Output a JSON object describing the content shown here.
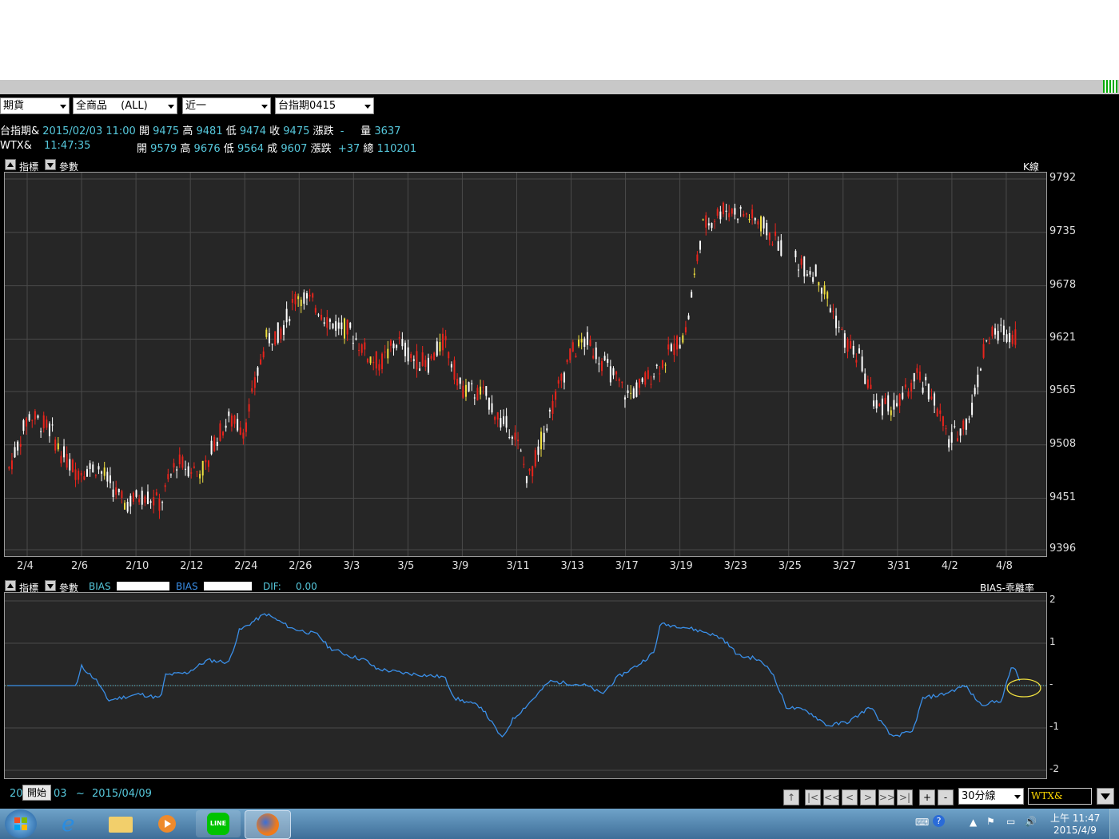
{
  "toolbar": {
    "market_select": "期貨",
    "product_select": "全商品　 (ALL)",
    "period_select": "近一",
    "contract_select": "台指期0415"
  },
  "quote_rows": [
    {
      "name": "台指期&",
      "time": "2015/02/03 11:00",
      "open_label": "開",
      "open": "9475",
      "high_label": "高",
      "high": "9481",
      "low_label": "低",
      "low": "9474",
      "close_label": "收",
      "close": "9475",
      "chg_label": "漲跌",
      "chg": "-",
      "vol_label": "量",
      "vol": "3637"
    },
    {
      "name": "WTX&",
      "time": "11:47:35",
      "open_label": "開",
      "open": "9579",
      "high_label": "高",
      "high": "9676",
      "low_label": "低",
      "low": "9564",
      "close_label": "成",
      "close": "9607",
      "chg_label": "漲跌",
      "chg": "+37",
      "vol_label": "總",
      "vol": "110201"
    }
  ],
  "upper_panel": {
    "indicator_label": "指標",
    "param_label": "參數",
    "chart_type_label": "K線"
  },
  "lower_panel": {
    "indicator_label": "指標",
    "param_label": "參數",
    "bias1_label": "BIAS",
    "bias2_label": "BIAS",
    "dif_label": "DIF:",
    "dif_value": "0.00",
    "title": "BIAS-乖離率"
  },
  "footer": {
    "date_start": "20",
    "start_button": "開始",
    "date_mid": "03",
    "tilde": "~",
    "date_end": "2015/04/09",
    "nav_buttons": [
      "↑",
      "|<",
      "<<",
      "<",
      ">",
      ">>",
      ">|"
    ],
    "zoom_buttons": [
      "+",
      "-"
    ],
    "interval_select": "30分線",
    "symbol_input": "WTX&"
  },
  "taskbar": {
    "clock_time": "上午 11:47",
    "clock_date": "2015/4/9",
    "line_label": "LINE"
  },
  "chart_data": [
    {
      "type": "candlestick",
      "title": "K線",
      "x_ticks": [
        "2/4",
        "2/6",
        "2/10",
        "2/12",
        "2/24",
        "2/26",
        "3/3",
        "3/5",
        "3/9",
        "3/11",
        "3/13",
        "3/17",
        "3/19",
        "3/23",
        "3/25",
        "3/27",
        "3/31",
        "4/2",
        "4/8"
      ],
      "y_ticks": [
        9792,
        9735,
        9678,
        9621,
        9565,
        9508,
        9451,
        9396
      ],
      "ylim": [
        9396,
        9792
      ],
      "x_range": [
        0,
        19.2
      ],
      "price_path": [
        [
          0.0,
          9480
        ],
        [
          0.4,
          9540
        ],
        [
          0.8,
          9525
        ],
        [
          1.0,
          9500
        ],
        [
          1.3,
          9480
        ],
        [
          1.7,
          9485
        ],
        [
          1.9,
          9470
        ],
        [
          2.2,
          9445
        ],
        [
          2.6,
          9455
        ],
        [
          2.9,
          9445
        ],
        [
          3.0,
          9460
        ],
        [
          3.2,
          9490
        ],
        [
          3.6,
          9480
        ],
        [
          3.8,
          9485
        ],
        [
          3.9,
          9510
        ],
        [
          4.2,
          9535
        ],
        [
          4.5,
          9525
        ],
        [
          4.9,
          9620
        ],
        [
          5.2,
          9630
        ],
        [
          5.5,
          9670
        ],
        [
          5.9,
          9655
        ],
        [
          6.1,
          9640
        ],
        [
          6.5,
          9630
        ],
        [
          6.9,
          9600
        ],
        [
          7.1,
          9595
        ],
        [
          7.4,
          9620
        ],
        [
          7.7,
          9600
        ],
        [
          8.0,
          9595
        ],
        [
          8.3,
          9620
        ],
        [
          8.6,
          9570
        ],
        [
          9.1,
          9560
        ],
        [
          9.4,
          9530
        ],
        [
          9.6,
          9525
        ],
        [
          9.9,
          9470
        ],
        [
          10.3,
          9540
        ],
        [
          10.7,
          9605
        ],
        [
          11.0,
          9620
        ],
        [
          11.4,
          9590
        ],
        [
          11.8,
          9560
        ],
        [
          12.1,
          9575
        ],
        [
          12.5,
          9600
        ],
        [
          12.9,
          9630
        ],
        [
          13.2,
          9740
        ],
        [
          13.6,
          9760
        ],
        [
          14.0,
          9755
        ],
        [
          14.3,
          9745
        ],
        [
          14.7,
          9720
        ],
        [
          15.1,
          9700
        ],
        [
          15.4,
          9690
        ],
        [
          15.9,
          9620
        ],
        [
          16.2,
          9600
        ],
        [
          16.5,
          9550
        ],
        [
          16.9,
          9550
        ],
        [
          17.3,
          9580
        ],
        [
          17.6,
          9560
        ],
        [
          17.9,
          9510
        ],
        [
          18.3,
          9540
        ],
        [
          18.6,
          9620
        ],
        [
          18.9,
          9630
        ],
        [
          19.2,
          9625
        ]
      ]
    },
    {
      "type": "line",
      "title": "BIAS-乖離率",
      "series_name": "BIAS",
      "y_ticks": [
        "2",
        "1",
        "-",
        "-1",
        "-2"
      ],
      "ylim": [
        -2,
        2
      ],
      "x_range": [
        0,
        19.2
      ],
      "values": [
        [
          0.0,
          0.0
        ],
        [
          1.3,
          0.0
        ],
        [
          1.4,
          0.45
        ],
        [
          1.7,
          0.1
        ],
        [
          1.9,
          -0.35
        ],
        [
          2.5,
          -0.2
        ],
        [
          2.9,
          -0.3
        ],
        [
          3.0,
          0.25
        ],
        [
          3.4,
          0.3
        ],
        [
          3.8,
          0.6
        ],
        [
          4.2,
          0.55
        ],
        [
          4.4,
          1.3
        ],
        [
          4.9,
          1.7
        ],
        [
          5.4,
          1.35
        ],
        [
          5.9,
          1.2
        ],
        [
          6.1,
          0.9
        ],
        [
          6.5,
          0.7
        ],
        [
          6.8,
          0.6
        ],
        [
          7.0,
          0.4
        ],
        [
          7.5,
          0.3
        ],
        [
          7.9,
          0.25
        ],
        [
          8.3,
          0.2
        ],
        [
          8.5,
          -0.3
        ],
        [
          9.0,
          -0.5
        ],
        [
          9.4,
          -1.25
        ],
        [
          9.6,
          -0.8
        ],
        [
          10.0,
          -0.3
        ],
        [
          10.3,
          0.1
        ],
        [
          10.7,
          0.05
        ],
        [
          11.0,
          0.0
        ],
        [
          11.3,
          -0.2
        ],
        [
          11.6,
          0.2
        ],
        [
          12.0,
          0.5
        ],
        [
          12.3,
          0.8
        ],
        [
          12.4,
          1.45
        ],
        [
          12.8,
          1.4
        ],
        [
          13.3,
          1.25
        ],
        [
          13.6,
          1.1
        ],
        [
          13.9,
          0.7
        ],
        [
          14.2,
          0.65
        ],
        [
          14.5,
          0.4
        ],
        [
          14.8,
          -0.5
        ],
        [
          15.2,
          -0.6
        ],
        [
          15.6,
          -0.95
        ],
        [
          16.0,
          -0.85
        ],
        [
          16.4,
          -0.5
        ],
        [
          16.8,
          -1.2
        ],
        [
          17.2,
          -1.1
        ],
        [
          17.4,
          -0.3
        ],
        [
          17.8,
          -0.2
        ],
        [
          18.2,
          0.0
        ],
        [
          18.5,
          -0.45
        ],
        [
          18.9,
          -0.35
        ],
        [
          19.1,
          0.5
        ],
        [
          19.25,
          0.1
        ]
      ]
    }
  ]
}
